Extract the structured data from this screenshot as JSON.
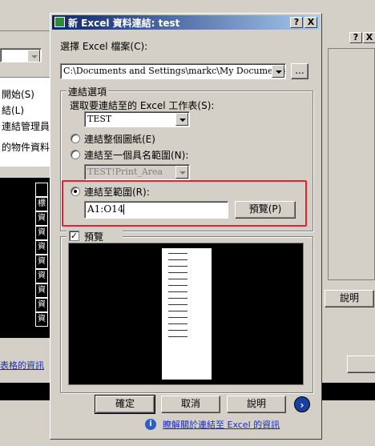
{
  "dialog": {
    "title": "新 Excel 資料連結: test",
    "help_btn": "?",
    "close_btn": "X",
    "select_file_label": "選擇 Excel 檔案(C):",
    "file_path": "C:\\Documents and Settings\\markc\\My Documents\\TEST",
    "browse_label": "...",
    "link_options_legend": "連結選項",
    "worksheet_label": "選取要連結至的 Excel 工作表(S):",
    "worksheet_value": "TEST",
    "opt_entire_sheet": "連結整個圖紙(E)",
    "opt_named_range": "連結至一個具名範圍(N):",
    "named_range_value": "TEST!Print_Area",
    "opt_range": "連結至範圍(R):",
    "range_value": "A1:O14",
    "preview_button": "預覽(P)",
    "preview_check_label": "預覽",
    "ok": "確定",
    "cancel": "取消",
    "help": "說明",
    "more": "›",
    "info_link": "瞭解關於連結至 Excel 的資訊"
  },
  "background": {
    "left_items": [
      "開始(S)",
      "結(L)",
      "連結管理員",
      "的物件資料"
    ],
    "left_link": "表格的資訊",
    "right_help": "說明",
    "right_close": "X",
    "right_help_q": "?",
    "table_cells": [
      "標",
      "資",
      "資",
      "資",
      "資",
      "資",
      "資",
      "資",
      "資",
      "資"
    ]
  },
  "colors": {
    "titlebar_start": "#0a246a",
    "titlebar_end": "#a6caf0",
    "highlight": "#e0232e",
    "link": "#1a2ac7"
  }
}
